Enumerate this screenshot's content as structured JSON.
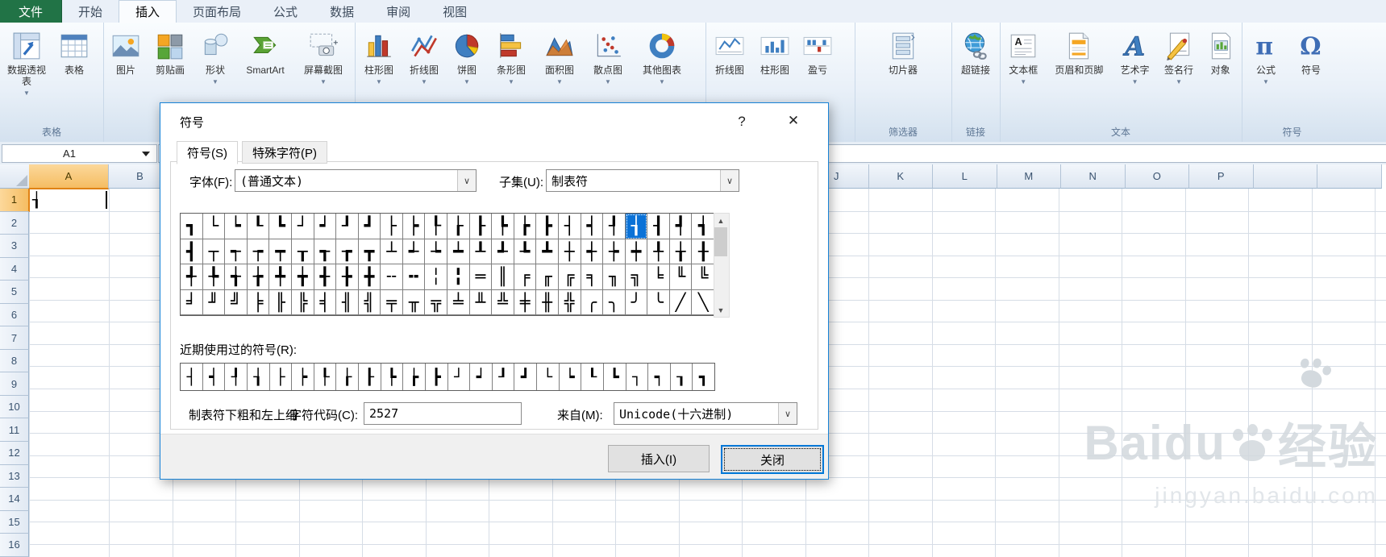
{
  "menu": {
    "file_label": "文件",
    "tabs": [
      {
        "label": "开始",
        "active": false
      },
      {
        "label": "插入",
        "active": true
      },
      {
        "label": "页面布局",
        "active": false
      },
      {
        "label": "公式",
        "active": false
      },
      {
        "label": "数据",
        "active": false
      },
      {
        "label": "审阅",
        "active": false
      },
      {
        "label": "视图",
        "active": false
      }
    ]
  },
  "ribbon": {
    "groups": [
      {
        "label": "表格",
        "items": [
          {
            "label": "数据透视表",
            "dropdown": true,
            "icon": "pivot-table"
          },
          {
            "label": "表格",
            "dropdown": false,
            "icon": "table"
          }
        ]
      },
      {
        "label": "",
        "items": [
          {
            "label": "图片",
            "dropdown": false,
            "icon": "picture"
          },
          {
            "label": "剪贴画",
            "dropdown": false,
            "icon": "clipart"
          },
          {
            "label": "形状",
            "dropdown": true,
            "icon": "shapes"
          },
          {
            "label": "SmartArt",
            "dropdown": false,
            "icon": "smartart"
          },
          {
            "label": "屏幕截图",
            "dropdown": true,
            "icon": "screenshot"
          }
        ]
      },
      {
        "label": "",
        "items": [
          {
            "label": "柱形图",
            "dropdown": true,
            "icon": "column-chart"
          },
          {
            "label": "折线图",
            "dropdown": true,
            "icon": "line-chart"
          },
          {
            "label": "饼图",
            "dropdown": true,
            "icon": "pie-chart"
          },
          {
            "label": "条形图",
            "dropdown": true,
            "icon": "bar-chart"
          },
          {
            "label": "面积图",
            "dropdown": true,
            "icon": "area-chart"
          },
          {
            "label": "散点图",
            "dropdown": true,
            "icon": "scatter-chart"
          },
          {
            "label": "其他图表",
            "dropdown": true,
            "icon": "other-charts"
          }
        ]
      },
      {
        "label": "",
        "items": [
          {
            "label": "折线图",
            "dropdown": false,
            "icon": "sparkline-line"
          },
          {
            "label": "柱形图",
            "dropdown": false,
            "icon": "sparkline-column"
          },
          {
            "label": "盈亏",
            "dropdown": false,
            "icon": "winloss"
          }
        ]
      },
      {
        "label": "筛选器",
        "items": [
          {
            "label": "切片器",
            "dropdown": false,
            "icon": "slicer"
          }
        ]
      },
      {
        "label": "链接",
        "items": [
          {
            "label": "超链接",
            "dropdown": false,
            "icon": "hyperlink"
          }
        ]
      },
      {
        "label": "文本",
        "items": [
          {
            "label": "文本框",
            "dropdown": true,
            "icon": "textbox"
          },
          {
            "label": "页眉和页脚",
            "dropdown": false,
            "icon": "header-footer"
          },
          {
            "label": "艺术字",
            "dropdown": true,
            "icon": "wordart"
          },
          {
            "label": "签名行",
            "dropdown": true,
            "icon": "signature-line"
          },
          {
            "label": "对象",
            "dropdown": false,
            "icon": "object"
          }
        ]
      },
      {
        "label": "符号",
        "items": [
          {
            "label": "公式",
            "dropdown": true,
            "icon": "equation"
          },
          {
            "label": "符号",
            "dropdown": false,
            "icon": "omega"
          }
        ]
      }
    ]
  },
  "formula_bar": {
    "name_box": "A1"
  },
  "sheet": {
    "left_columns": {
      "a": "A",
      "b": "B"
    },
    "right_columns": [
      "J",
      "K",
      "L",
      "M",
      "N",
      "O",
      "P",
      "",
      ""
    ],
    "rows": [
      "1",
      "2",
      "3",
      "4",
      "5",
      "6",
      "7",
      "8",
      "9",
      "10",
      "11",
      "12",
      "13",
      "14",
      "15",
      "16"
    ],
    "active_cell": {
      "ref": "A1",
      "text": "┧"
    }
  },
  "dialog": {
    "title": "符号",
    "help_label": "?",
    "close_label": "✕",
    "tabs": [
      {
        "label": "符号(S)",
        "active": true
      },
      {
        "label": "特殊字符(P)",
        "active": false
      }
    ],
    "font_label": "字体(F):",
    "font_value": "(普通文本)",
    "subset_label": "子集(U):",
    "subset_value": "制表符",
    "selected_index": 20,
    "selected_char": "┧",
    "cells": [
      "┓",
      "└",
      "┕",
      "┖",
      "┗",
      "┘",
      "┙",
      "┚",
      "┛",
      "├",
      "┝",
      "┞",
      "┟",
      "┠",
      "┡",
      "┢",
      "┣",
      "┤",
      "┥",
      "┦",
      "┧",
      "┨",
      "┩",
      "┪",
      "┫",
      "┬",
      "┭",
      "┮",
      "┯",
      "┰",
      "┱",
      "┲",
      "┳",
      "┴",
      "┵",
      "┶",
      "┷",
      "┸",
      "┹",
      "┺",
      "┻",
      "┼",
      "┽",
      "┾",
      "┿",
      "╀",
      "╁",
      "╂",
      "╃",
      "╄",
      "╅",
      "╆",
      "╇",
      "╈",
      "╉",
      "╊",
      "╋",
      "╌",
      "╍",
      "╎",
      "╏",
      "═",
      "║",
      "╒",
      "╓",
      "╔",
      "╕",
      "╖",
      "╗",
      "╘",
      "╙",
      "╚",
      "╛",
      "╜",
      "╝",
      "╞",
      "╟",
      "╠",
      "╡",
      "╢",
      "╣",
      "╤",
      "╥",
      "╦",
      "╧",
      "╨",
      "╩",
      "╪",
      "╫",
      "╬",
      "╭",
      "╮",
      "╯",
      "╰",
      "╱",
      "╲"
    ],
    "recent_label": "近期使用过的符号(R):",
    "recent": [
      "┤",
      "┥",
      "┦",
      "┧",
      "├",
      "┝",
      "┞",
      "┟",
      "┠",
      "┡",
      "┢",
      "┣",
      "┘",
      "┙",
      "┚",
      "┛",
      "└",
      "┕",
      "┖",
      "┗",
      "┐",
      "┑",
      "┒",
      "┓"
    ],
    "char_name": "制表符下粗和左上细",
    "char_code_label": "字符代码(C):",
    "char_code": "2527",
    "from_label": "来自(M):",
    "from_value": "Unicode(十六进制)",
    "insert_button": "插入(I)",
    "close_button": "关闭"
  },
  "watermark": {
    "brand": "Baidu",
    "suffix": "经验",
    "url": "jingyan.baidu.com"
  },
  "colors": {
    "accent_blue": "#0b72d7",
    "file_tab_green": "#217346",
    "selected_header": "#f5bd62"
  }
}
